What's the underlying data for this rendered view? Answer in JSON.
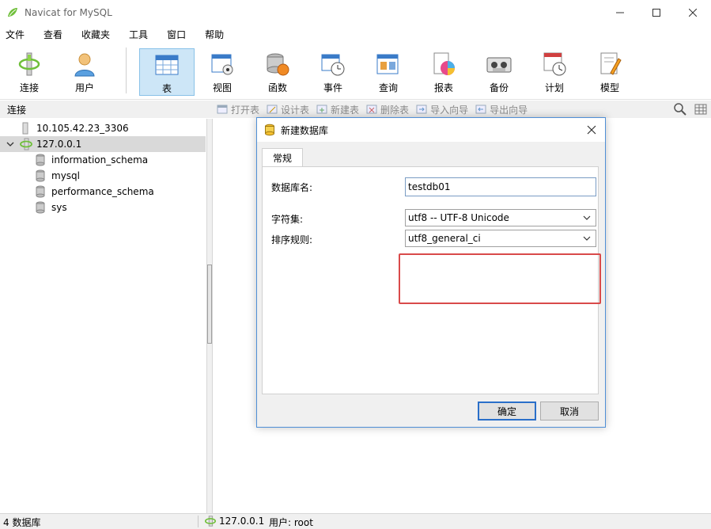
{
  "window": {
    "title": "Navicat for MySQL"
  },
  "menu": [
    "文件",
    "查看",
    "收藏夹",
    "工具",
    "窗口",
    "帮助"
  ],
  "toolbar": [
    {
      "label": "连接",
      "icon": "connection-icon"
    },
    {
      "label": "用户",
      "icon": "user-icon"
    },
    {
      "label": "表",
      "icon": "table-icon",
      "active": true
    },
    {
      "label": "视图",
      "icon": "view-icon"
    },
    {
      "label": "函数",
      "icon": "function-icon"
    },
    {
      "label": "事件",
      "icon": "event-icon"
    },
    {
      "label": "查询",
      "icon": "query-icon"
    },
    {
      "label": "报表",
      "icon": "report-icon"
    },
    {
      "label": "备份",
      "icon": "backup-icon"
    },
    {
      "label": "计划",
      "icon": "schedule-icon"
    },
    {
      "label": "模型",
      "icon": "model-icon"
    }
  ],
  "left_header": "连接",
  "object_toolbar": [
    "打开表",
    "设计表",
    "新建表",
    "删除表",
    "导入向导",
    "导出向导"
  ],
  "tree": {
    "connections": [
      {
        "label": "10.105.42.23_3306",
        "expanded": false
      },
      {
        "label": "127.0.0.1",
        "expanded": true,
        "selected": true,
        "databases": [
          "information_schema",
          "mysql",
          "performance_schema",
          "sys"
        ]
      }
    ]
  },
  "status": {
    "count": "4 数据库",
    "connection": "127.0.0.1",
    "user": "用户: root"
  },
  "dialog": {
    "title": "新建数据库",
    "tab": "常规",
    "fields": {
      "db_name_label": "数据库名:",
      "db_name_value": "testdb01",
      "charset_label": "字符集:",
      "charset_value": "utf8 -- UTF-8 Unicode",
      "collation_label": "排序规则:",
      "collation_value": "utf8_general_ci"
    },
    "ok": "确定",
    "cancel": "取消"
  },
  "colors": {
    "accent": "#2a6fc9",
    "highlight": "#d94a4a",
    "active_tool": "#cde6f7"
  }
}
